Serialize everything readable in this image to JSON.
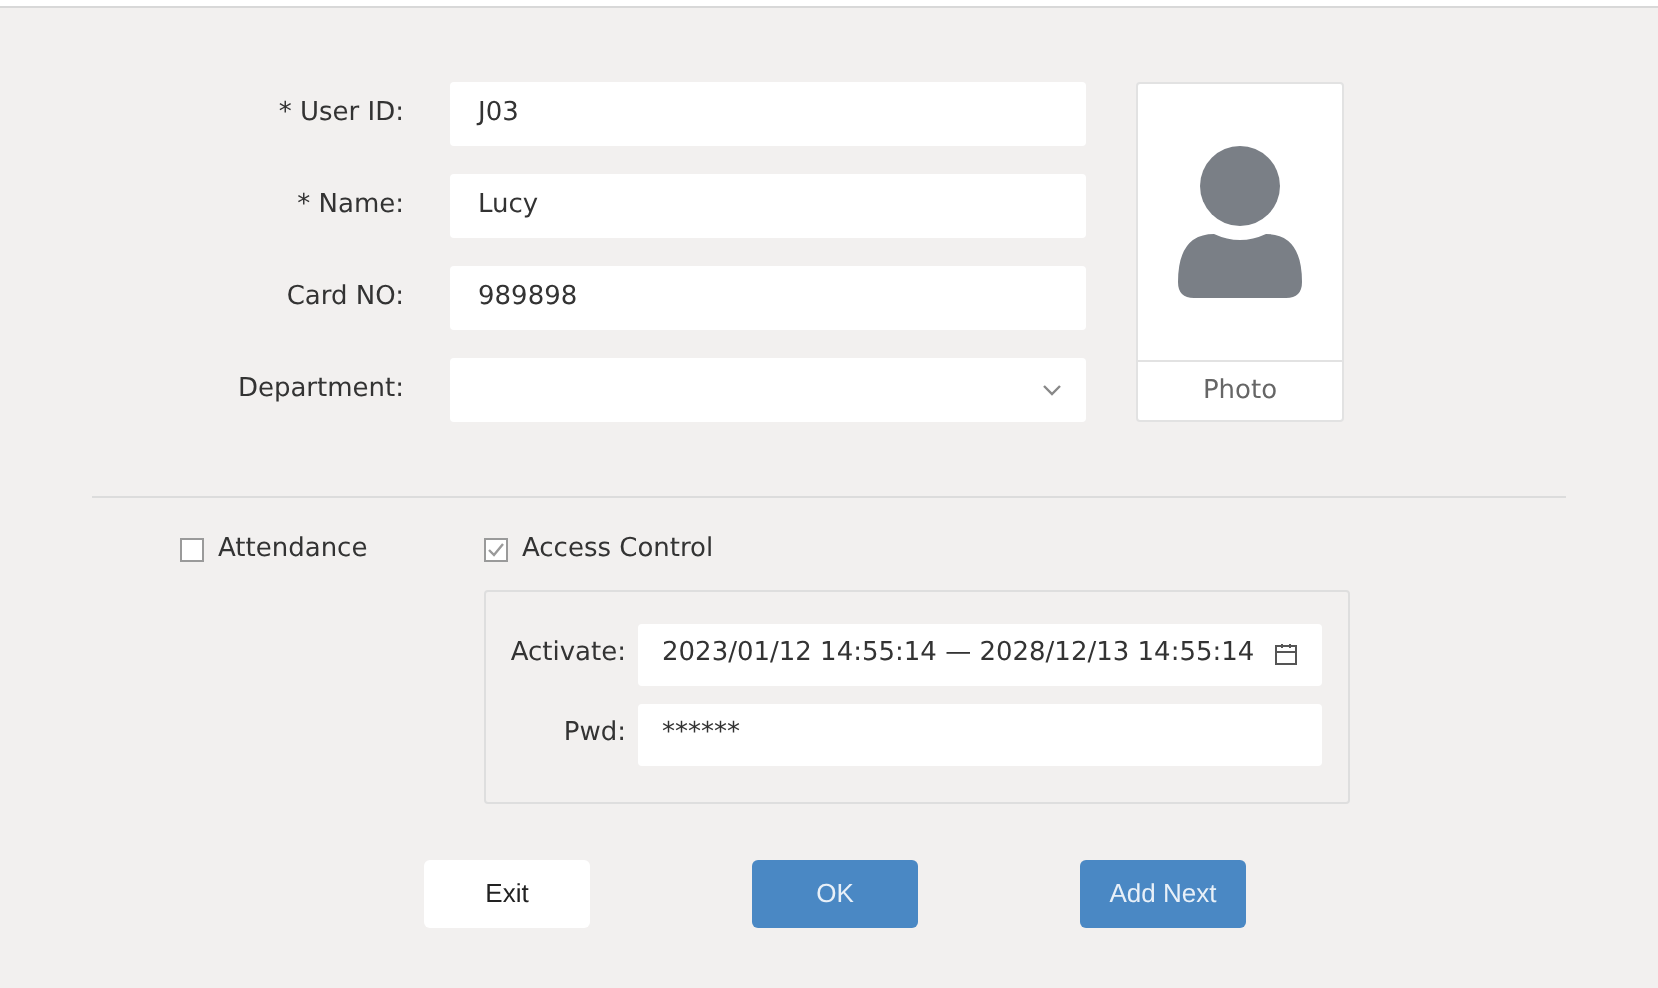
{
  "fields": [
    {
      "kind": "text",
      "label": "* User ID:",
      "value": "J03"
    },
    {
      "kind": "text",
      "label": "* Name:",
      "value": "Lucy"
    },
    {
      "kind": "text",
      "label": "Card NO:",
      "value": "989898"
    },
    {
      "kind": "select",
      "label": "Department:"
    }
  ],
  "photo": {
    "label": "Photo"
  },
  "options": [
    {
      "label": "Attendance",
      "checked": false
    },
    {
      "label": "Access Control",
      "checked": true
    }
  ],
  "access": {
    "activate": {
      "label": "Activate:",
      "value": "2023/01/12 14:55:14 — 2028/12/13 14:55:14"
    },
    "pwd": {
      "label": "Pwd:",
      "value": "******"
    }
  },
  "buttons": [
    {
      "label": "Exit",
      "kind": "secondary"
    },
    {
      "label": "OK",
      "kind": "primary"
    },
    {
      "label": "Add Next",
      "kind": "primary"
    }
  ]
}
